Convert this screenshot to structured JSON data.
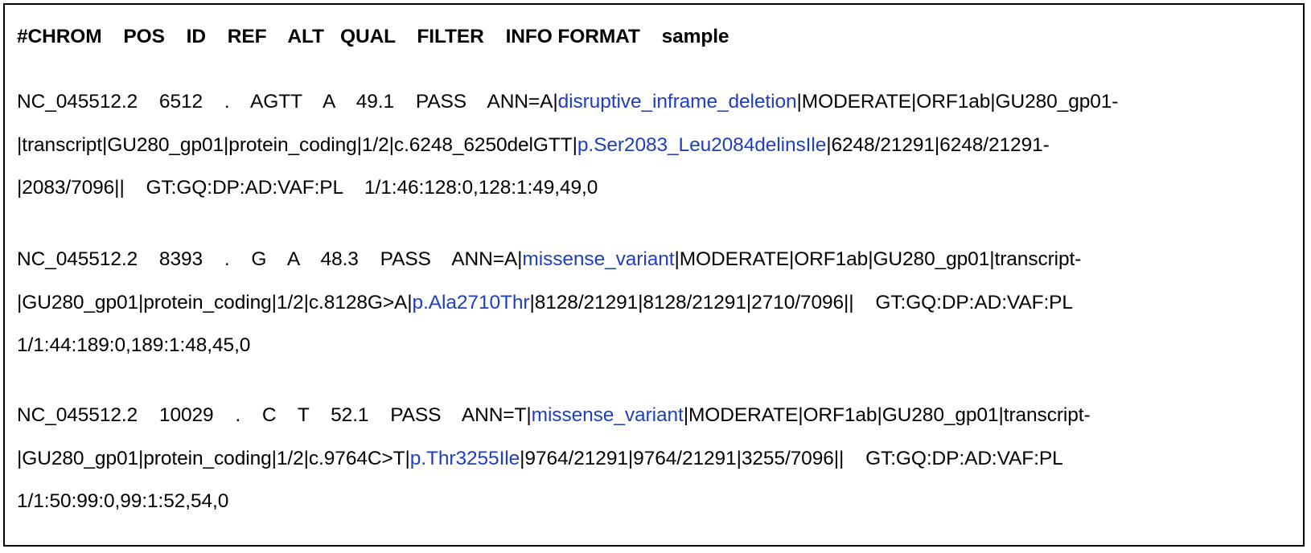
{
  "header": "#CHROM    POS    ID    REF    ALT   QUAL    FILTER    INFO FORMAT    sample",
  "colors": {
    "highlight": "#1f3fbf",
    "text": "#000000",
    "border": "#000000"
  },
  "records": [
    {
      "line1": {
        "pre": "NC_045512.2    6512    .    AGTT    A    49.1    PASS    ANN=A|",
        "hl": "disruptive_inframe_deletion",
        "post": "|MODERATE|ORF1ab|GU280_gp01-"
      },
      "line2": {
        "pre": "|transcript|GU280_gp01|protein_coding|1/2|c.6248_6250delGTT|",
        "hl": "p.Ser2083_Leu2084delinsIle",
        "post": "|6248/21291|6248/21291-"
      },
      "line3": {
        "text": "|2083/7096||    GT:GQ:DP:AD:VAF:PL    1/1:46:128:0,128:1:49,49,0"
      }
    },
    {
      "line1": {
        "pre": "NC_045512.2    8393    .    G    A    48.3    PASS    ANN=A|",
        "hl": "missense_variant",
        "post": "|MODERATE|ORF1ab|GU280_gp01|transcript-"
      },
      "line2": {
        "pre": "|GU280_gp01|protein_coding|1/2|c.8128G>A|",
        "hl": "p.Ala2710Thr",
        "post": "|8128/21291|8128/21291|2710/7096||    GT:GQ:DP:AD:VAF:PL"
      },
      "line3": {
        "text": "1/1:44:189:0,189:1:48,45,0"
      }
    },
    {
      "line1": {
        "pre": "NC_045512.2    10029    .    C    T    52.1    PASS    ANN=T|",
        "hl": "missense_variant",
        "post": "|MODERATE|ORF1ab|GU280_gp01|transcript-"
      },
      "line2": {
        "pre": "|GU280_gp01|protein_coding|1/2|c.9764C>T|",
        "hl": "p.Thr3255Ile",
        "post": "|9764/21291|9764/21291|3255/7096||    GT:GQ:DP:AD:VAF:PL"
      },
      "line3": {
        "text": "1/1:50:99:0,99:1:52,54,0"
      }
    }
  ]
}
